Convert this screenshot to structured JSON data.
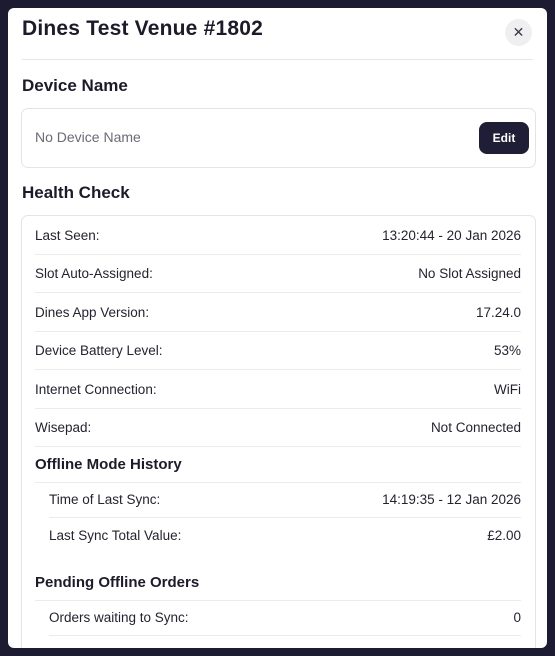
{
  "modal": {
    "title": "Dines Test Venue #1802",
    "close_icon": "close-icon",
    "close_glyph": "✕"
  },
  "device": {
    "section_title": "Device Name",
    "placeholder": "No Device Name",
    "edit_label": "Edit"
  },
  "health": {
    "section_title": "Health Check",
    "rows": [
      {
        "label": "Last Seen:",
        "value": "13:20:44 - 20 Jan 2026"
      },
      {
        "label": "Slot Auto-Assigned:",
        "value": "No Slot Assigned"
      },
      {
        "label": "Dines App Version:",
        "value": "17.24.0"
      },
      {
        "label": "Device Battery Level:",
        "value": "53%"
      },
      {
        "label": "Internet Connection:",
        "value": "WiFi"
      },
      {
        "label": "Wisepad:",
        "value": "Not Connected"
      }
    ],
    "offline_history": {
      "title": "Offline Mode History",
      "rows": [
        {
          "label": "Time of Last Sync:",
          "value": "14:19:35 - 12 Jan 2026"
        },
        {
          "label": "Last Sync Total Value:",
          "value": "£2.00"
        }
      ]
    },
    "pending_orders": {
      "title": "Pending Offline Orders",
      "rows": [
        {
          "label": "Orders waiting to Sync:",
          "value": "0"
        }
      ]
    }
  }
}
